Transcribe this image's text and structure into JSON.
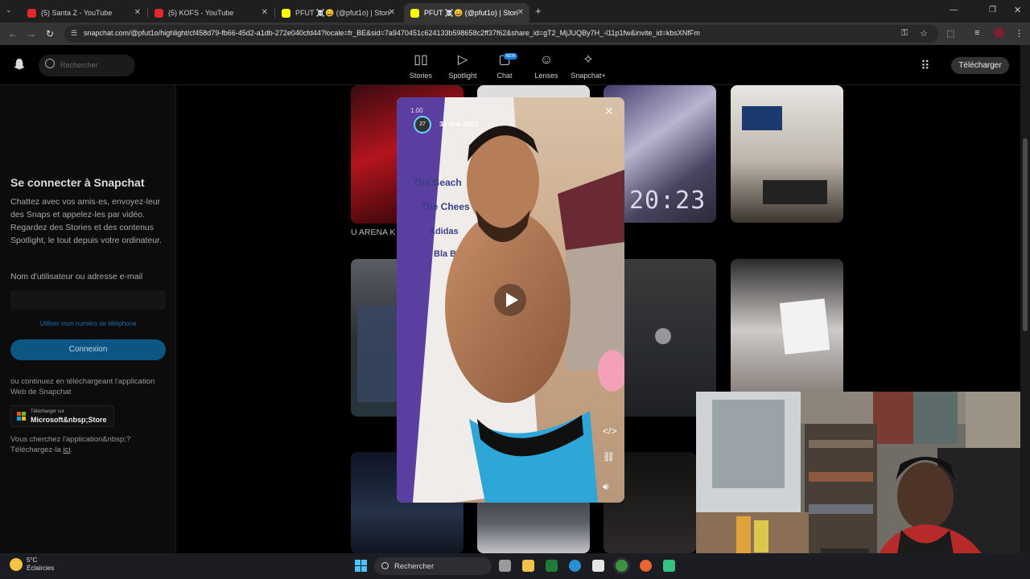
{
  "browser": {
    "tabs": [
      {
        "label": "(5) Santa Z - YouTube",
        "favicon": "youtube-icon"
      },
      {
        "label": "(5) KOFS - YouTube",
        "favicon": "youtube-icon"
      },
      {
        "label": "PFUT ☠️😀 (@pfut1o) | Stories,",
        "favicon": "snapchat-icon"
      },
      {
        "label": "PFUT ☠️😀 (@pfut1o) | Stori",
        "favicon": "snapchat-icon",
        "active": true
      }
    ],
    "url": "snapchat.com/@pfut1o/highlight/cf458d79-fb66-45d2-a1db-272e040cfd44?locale=fr_BE&sid=7a9470451c624133b598658c2ff37f62&share_id=gT2_MjJUQBy7H_-l11p1fw&invite_id=kbsXNfFm"
  },
  "snapchat": {
    "search_placeholder": "Rechercher",
    "nav": [
      {
        "label": "Stories",
        "icon": "stories-icon"
      },
      {
        "label": "Spotlight",
        "icon": "spotlight-icon"
      },
      {
        "label": "Chat",
        "icon": "chat-icon"
      },
      {
        "label": "Lenses",
        "icon": "lenses-icon"
      },
      {
        "label": "Snapchat+",
        "icon": "snapchat-plus-icon"
      }
    ],
    "chat_badge": "NEW",
    "download_button": "Télécharger"
  },
  "login_panel": {
    "title": "Se connecter à Snapchat",
    "description": "Chattez avec vos amis·es, envoyez-leur des Snaps et appelez-les par vidéo. Regardez des Stories et des contenus Spotlight, le tout depuis votre ordinateur.",
    "username_label": "Nom d'utilisateur ou adresse e-mail",
    "phone_link": "Utiliser mon numéro de téléphone",
    "login_button": "Connexion",
    "alt_text": "ou continuez en téléchargeant l'application Web de Snapchat",
    "store_small": "Télécharger sur",
    "store_big": "Microsoft&nbsp;Store",
    "footer_prefix": "Vous cherchez l'application&nbsp;? Téléchargez-la ",
    "footer_link": "ici",
    "footer_suffix": "."
  },
  "grid": {
    "tile_caption": "U ARENA K"
  },
  "story": {
    "counter": "1.00",
    "avatar_text": "27",
    "date": "31 mai 2022"
  },
  "taskbar": {
    "weather_temp": "5°C",
    "weather_desc": "Éclaircies",
    "search_label": "Rechercher"
  }
}
